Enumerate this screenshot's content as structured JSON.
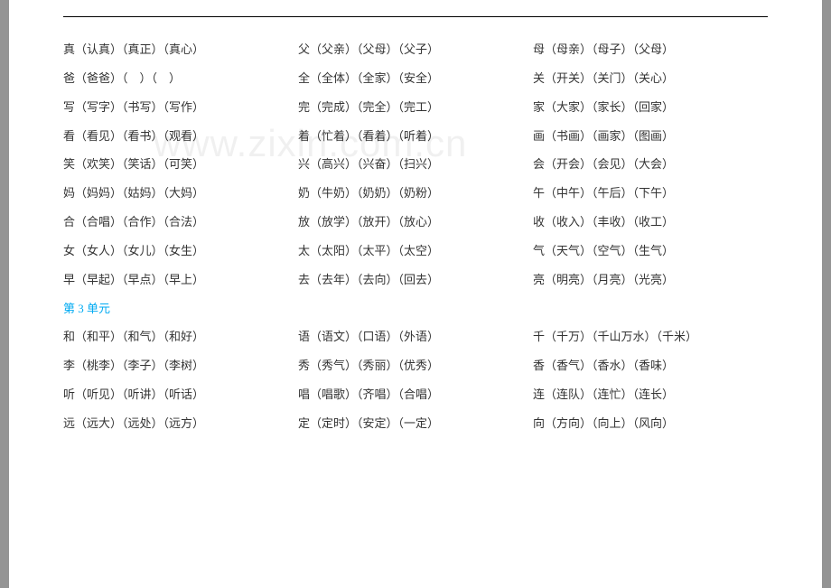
{
  "watermark": "www.zixin.com.cn",
  "rows": [
    {
      "c1": "真（认真）（真正）（真心）",
      "c2": "父（父亲）（父母）（父子）",
      "c3": "母（母亲）（母子）（父母）"
    },
    {
      "c1": "爸（爸爸）（　）（　）",
      "c2": "全（全体）（全家）（安全）",
      "c3": "关（开关）（关门）（关心）"
    },
    {
      "c1": "写（写字）（书写）（写作）",
      "c2": "完（完成）（完全）（完工）",
      "c3": "家（大家）（家长）（回家）"
    },
    {
      "c1": "看（看见）（看书）（观看）",
      "c2": "着（忙着）（看着）（听着）",
      "c3": "画（书画）（画家）（图画）"
    },
    {
      "c1": "笑（欢笑）（笑话）（可笑）",
      "c2": "兴（高兴）（兴奋）（扫兴）",
      "c3": "会（开会）（会见）（大会）"
    },
    {
      "c1": "妈（妈妈）（姑妈）（大妈）",
      "c2": "奶（牛奶）（奶奶）（奶粉）",
      "c3": "午（中午）（午后）（下午）"
    },
    {
      "c1": "合（合唱）（合作）（合法）",
      "c2": "放（放学）（放开）（放心）",
      "c3": "收（收入）（丰收）（收工）"
    },
    {
      "c1": "女（女人）（女儿）（女生）",
      "c2": "太（太阳）（太平）（太空）",
      "c3": "气（天气）（空气）（生气）"
    },
    {
      "c1": "早（早起）（早点）（早上）",
      "c2": "去（去年）（去向）（回去）",
      "c3": "亮（明亮）（月亮）（光亮）"
    }
  ],
  "unit_heading": "第 3 单元",
  "rows2": [
    {
      "c1": "和（和平）（和气）（和好）",
      "c2": "语（语文）（口语）（外语）",
      "c3": "千（千万）（千山万水）（千米）"
    },
    {
      "c1": "李（桃李）（李子）（李树）",
      "c2": "秀（秀气）（秀丽）（优秀）",
      "c3": "香（香气）（香水）（香味）"
    },
    {
      "c1": "听（听见）（听讲）（听话）",
      "c2": "唱（唱歌）（齐唱）（合唱）",
      "c3": "连（连队）（连忙）（连长）"
    },
    {
      "c1": "远（远大）（远处）（远方）",
      "c2": "定（定时）（安定）（一定）",
      "c3": "向（方向）（向上）（风向）"
    }
  ]
}
